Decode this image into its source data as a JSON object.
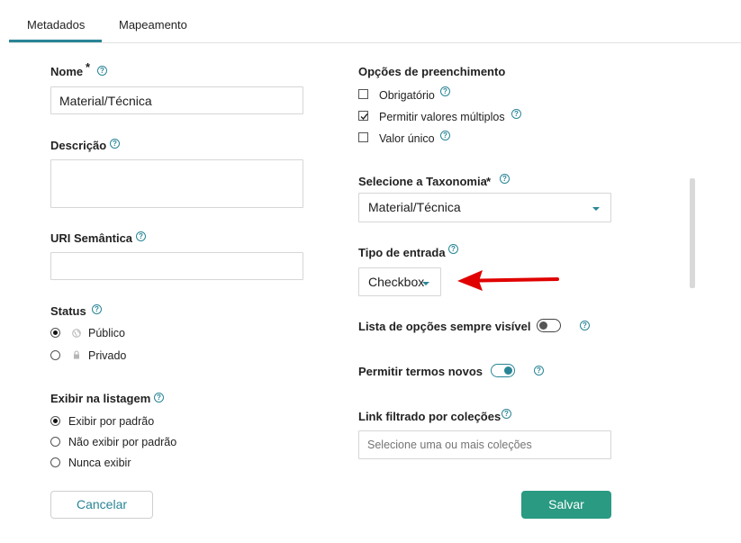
{
  "tabs": {
    "metadata": "Metadados",
    "mapping": "Mapeamento"
  },
  "help_glyph": "?",
  "required_mark": "*",
  "left": {
    "name_label": "Nome",
    "name_value": "Material/Técnica",
    "description_label": "Descrição",
    "uri_label": "URI Semântica",
    "status_label": "Status",
    "status_options": [
      "Público",
      "Privado"
    ],
    "listing_label": "Exibir na listagem",
    "listing_options": [
      "Exibir por padrão",
      "Não exibir por padrão",
      "Nunca exibir"
    ]
  },
  "right": {
    "fill_options_label": "Opções de preenchimento",
    "fill_options": [
      "Obrigatório",
      "Permitir valores múltiplos",
      "Valor único"
    ],
    "taxonomy_label": "Selecione a Taxonomia",
    "taxonomy_value": "Material/Técnica",
    "entry_type_label": "Tipo de entrada",
    "entry_type_value": "Checkbox",
    "always_visible_label": "Lista de opções sempre visível",
    "allow_new_terms_label": "Permitir termos novos",
    "filtered_link_label": "Link filtrado por coleções",
    "collections_placeholder": "Selecione uma ou mais coleções"
  },
  "state": {
    "status_selected": "Público",
    "listing_selected": "Exibir por padrão",
    "fill_checked": [
      "Permitir valores múltiplos"
    ],
    "always_visible_on": false,
    "allow_new_terms_on": true
  },
  "buttons": {
    "cancel": "Cancelar",
    "save": "Salvar"
  },
  "colors": {
    "accent": "#298596",
    "save_button": "#2a9a82",
    "annotation_arrow": "#e00000"
  },
  "icons": [
    "globe-icon",
    "lock-icon",
    "help-icon",
    "caret-down-icon",
    "checkmark-icon",
    "red-arrow-icon"
  ]
}
